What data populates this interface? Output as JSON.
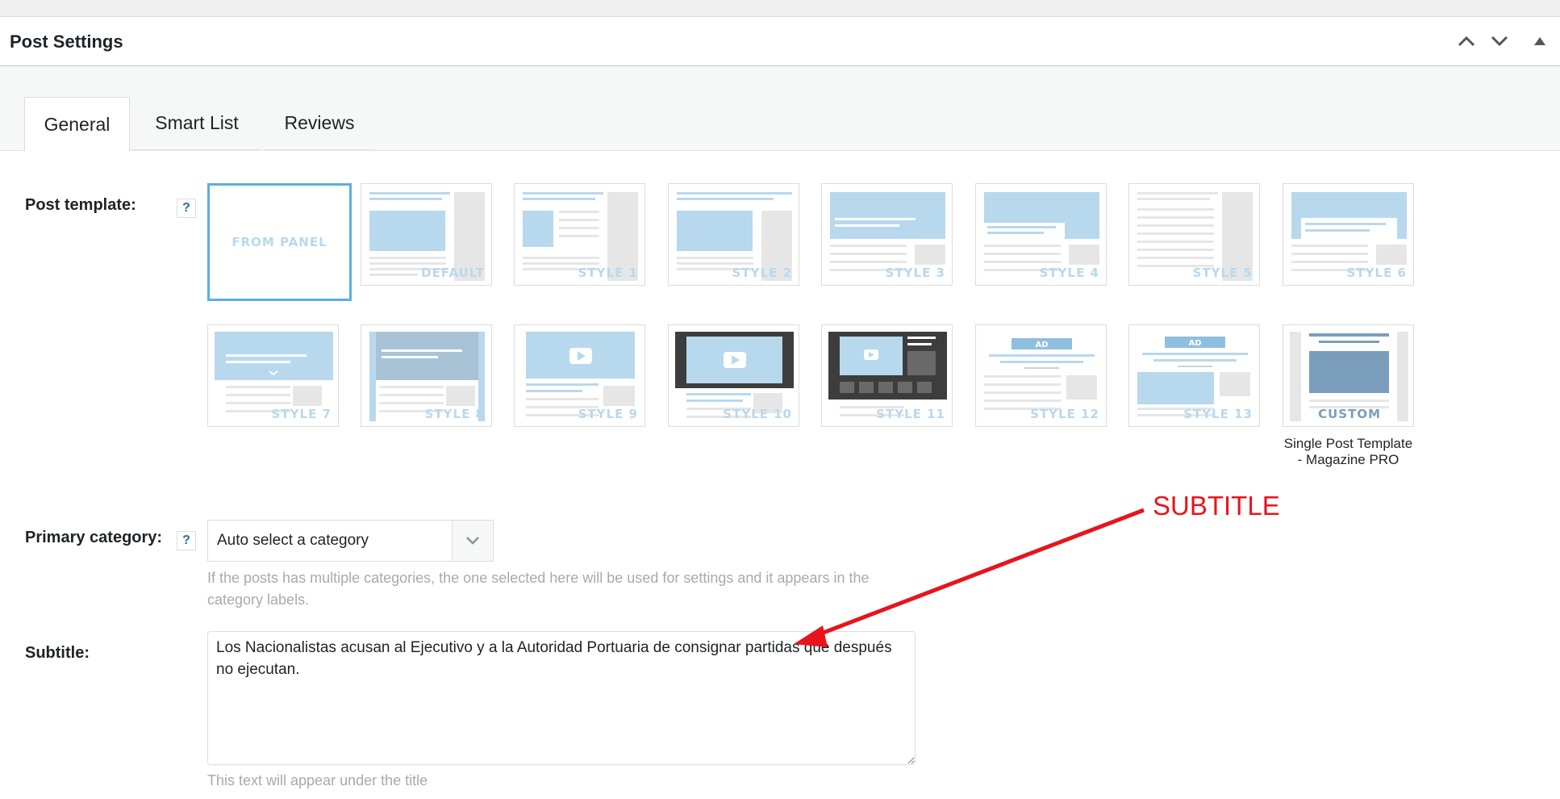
{
  "panel": {
    "title": "Post Settings",
    "move_up_icon": "chevron-up-icon",
    "move_down_icon": "chevron-down-icon",
    "toggle_icon": "triangle-up-icon"
  },
  "tabs": [
    {
      "label": "General",
      "active": true
    },
    {
      "label": "Smart List",
      "active": false
    },
    {
      "label": "Reviews",
      "active": false
    }
  ],
  "post_template": {
    "label": "Post template:",
    "help": "?",
    "templates": [
      {
        "caption": "FROM PANEL",
        "selected": true
      },
      {
        "caption": "DEFAULT"
      },
      {
        "caption": "STYLE 1"
      },
      {
        "caption": "STYLE 2"
      },
      {
        "caption": "STYLE 3"
      },
      {
        "caption": "STYLE 4"
      },
      {
        "caption": "STYLE 5"
      },
      {
        "caption": "STYLE 6"
      },
      {
        "caption": "STYLE 7"
      },
      {
        "caption": "STYLE 8"
      },
      {
        "caption": "STYLE 9"
      },
      {
        "caption": "STYLE 10"
      },
      {
        "caption": "STYLE 11"
      },
      {
        "caption": "STYLE 12"
      },
      {
        "caption": "STYLE 13"
      },
      {
        "caption": "CUSTOM"
      }
    ],
    "ad_label": "AD",
    "custom_note": "Single Post Template - Magazine PRO"
  },
  "primary_category": {
    "label": "Primary category:",
    "help": "?",
    "value": "Auto select a category",
    "hint": "If the posts has multiple categories, the one selected here will be used for settings and it appears in the category labels."
  },
  "subtitle": {
    "label": "Subtitle:",
    "value": "Los Nacionalistas acusan al Ejecutivo y a la Autoridad Portuaria de consignar partidas que después no ejecutan.",
    "hint": "This text will appear under the title"
  },
  "annotation": {
    "text": "SUBTITLE",
    "color": "#e8141c"
  },
  "colors": {
    "accent": "#5aaee3",
    "thumb_blue": "#b8d8ee",
    "thumb_gray": "#e6e6e6"
  }
}
